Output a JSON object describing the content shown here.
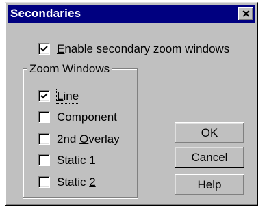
{
  "dialog": {
    "title": "Secondaries",
    "close_icon": "close-icon"
  },
  "enable_option": {
    "pre": "",
    "accel": "E",
    "post": "nable secondary zoom windows",
    "checked": true
  },
  "zoom_group": {
    "title": "Zoom Windows",
    "items": [
      {
        "pre": "",
        "accel": "L",
        "post": "ine",
        "checked": true
      },
      {
        "pre": "",
        "accel": "C",
        "post": "omponent",
        "checked": false
      },
      {
        "pre": "2nd ",
        "accel": "O",
        "post": "verlay",
        "checked": false
      },
      {
        "pre": "Static ",
        "accel": "1",
        "post": "",
        "checked": false
      },
      {
        "pre": "Static ",
        "accel": "2",
        "post": "",
        "checked": false
      }
    ]
  },
  "buttons": {
    "ok": "OK",
    "cancel": "Cancel",
    "help": "Help"
  }
}
